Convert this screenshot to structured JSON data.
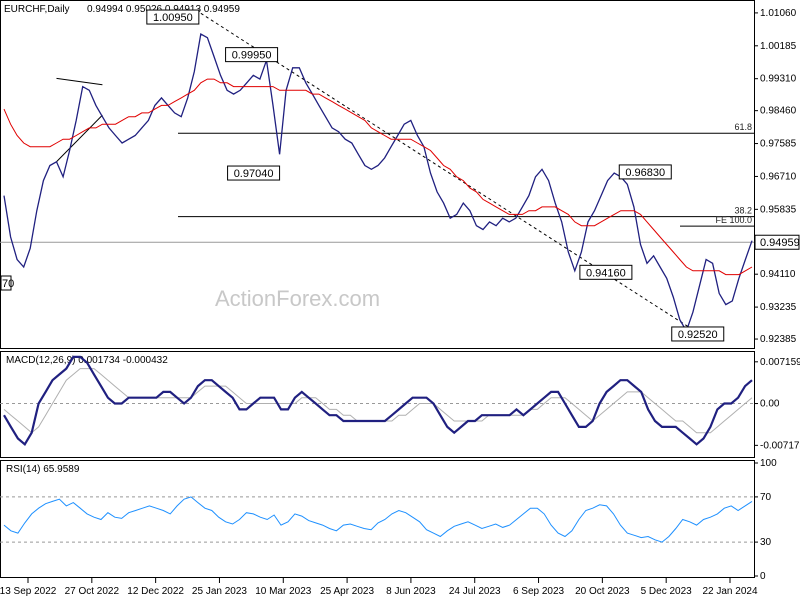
{
  "chart_data": {
    "type": "line",
    "symbol_line": "EURCHF,Daily",
    "ohlc_line": "0.94994 0.95026 0.94913 0.94959",
    "watermark": "ActionForex.com",
    "x_ticks": [
      "13 Sep 2022",
      "27 Oct 2022",
      "12 Dec 2022",
      "25 Jan 2023",
      "10 Mar 2023",
      "25 Apr 2023",
      "8 Jun 2023",
      "24 Jul 2023",
      "6 Sep 2023",
      "20 Oct 2023",
      "5 Dec 2023",
      "22 Jan 2024"
    ],
    "price_panel": {
      "ylim": [
        0.922,
        1.0135
      ],
      "y_ticks": [
        "1.01060",
        "1.00185",
        "0.99310",
        "0.98460",
        "0.97585",
        "0.96710",
        "0.95835",
        "0.94959",
        "0.94110",
        "0.93235",
        "0.92385"
      ],
      "last_price": "0.94959",
      "series": [
        {
          "type": "line",
          "color": "#202080",
          "values": [
            0.962,
            0.951,
            0.945,
            0.943,
            0.948,
            0.958,
            0.966,
            0.97,
            0.971,
            0.967,
            0.974,
            0.982,
            0.991,
            0.99,
            0.986,
            0.983,
            0.98,
            0.978,
            0.976,
            0.977,
            0.978,
            0.98,
            0.982,
            0.986,
            0.988,
            0.986,
            0.984,
            0.983,
            0.988,
            0.995,
            1.005,
            1.004,
            0.999,
            0.994,
            0.99,
            0.989,
            0.99,
            0.992,
            0.994,
            0.993,
            0.998,
            0.986,
            0.973,
            0.99,
            0.996,
            0.996,
            0.992,
            0.989,
            0.986,
            0.983,
            0.98,
            0.979,
            0.977,
            0.976,
            0.973,
            0.97,
            0.969,
            0.97,
            0.972,
            0.975,
            0.978,
            0.981,
            0.982,
            0.978,
            0.975,
            0.968,
            0.963,
            0.96,
            0.956,
            0.957,
            0.96,
            0.958,
            0.954,
            0.953,
            0.955,
            0.954,
            0.956,
            0.955,
            0.956,
            0.959,
            0.962,
            0.967,
            0.969,
            0.966,
            0.96,
            0.955,
            0.947,
            0.942,
            0.947,
            0.955,
            0.958,
            0.962,
            0.966,
            0.968,
            0.967,
            0.965,
            0.959,
            0.949,
            0.944,
            0.946,
            0.943,
            0.94,
            0.935,
            0.929,
            0.926,
            0.931,
            0.938,
            0.945,
            0.944,
            0.936,
            0.933,
            0.934,
            0.94,
            0.945,
            0.95
          ]
        },
        {
          "name": "",
          "type": "line",
          "color": "#e00000",
          "values": [
            0.985,
            0.981,
            0.978,
            0.976,
            0.975,
            0.975,
            0.975,
            0.975,
            0.976,
            0.977,
            0.977,
            0.978,
            0.979,
            0.98,
            0.98,
            0.981,
            0.981,
            0.981,
            0.982,
            0.983,
            0.983,
            0.984,
            0.984,
            0.985,
            0.986,
            0.986,
            0.987,
            0.988,
            0.989,
            0.99,
            0.992,
            0.993,
            0.993,
            0.992,
            0.992,
            0.991,
            0.991,
            0.991,
            0.991,
            0.991,
            0.991,
            0.991,
            0.99,
            0.99,
            0.99,
            0.99,
            0.99,
            0.989,
            0.989,
            0.988,
            0.987,
            0.986,
            0.985,
            0.984,
            0.983,
            0.982,
            0.98,
            0.979,
            0.978,
            0.977,
            0.977,
            0.977,
            0.977,
            0.976,
            0.975,
            0.974,
            0.972,
            0.97,
            0.969,
            0.967,
            0.966,
            0.964,
            0.963,
            0.961,
            0.96,
            0.959,
            0.958,
            0.957,
            0.957,
            0.957,
            0.958,
            0.958,
            0.959,
            0.959,
            0.959,
            0.958,
            0.957,
            0.955,
            0.954,
            0.954,
            0.954,
            0.955,
            0.956,
            0.957,
            0.958,
            0.958,
            0.958,
            0.957,
            0.955,
            0.953,
            0.951,
            0.949,
            0.947,
            0.945,
            0.943,
            0.942,
            0.942,
            0.942,
            0.942,
            0.942,
            0.941,
            0.941,
            0.941,
            0.942,
            0.943
          ]
        }
      ],
      "levels": [
        {
          "label": "61.8",
          "value": 0.9786
        },
        {
          "label": "38.2",
          "value": 0.9564
        },
        {
          "label": "",
          "value": 0.9496
        }
      ],
      "fe_segment": {
        "label": "FE 100.0",
        "value": 0.9539
      },
      "trendlines": [
        {
          "style": "solid",
          "points": [
            [
              8,
              0.9932
            ],
            [
              15,
              0.9915
            ]
          ]
        },
        {
          "style": "solid",
          "points": [
            [
              8,
              0.971
            ],
            [
              15,
              0.9834
            ]
          ]
        },
        {
          "style": "dashed",
          "points": [
            [
              30,
              1.0105
            ],
            [
              106,
              0.9252
            ]
          ]
        }
      ],
      "annotations": [
        {
          "text": "1.00950",
          "value": 1.0095,
          "idx": 30,
          "pos": "left"
        },
        {
          "text": "0.99950",
          "value": 0.9995,
          "idx": 42,
          "pos": "left"
        },
        {
          "text": "0.97040",
          "value": 0.9704,
          "idx": 42,
          "pos": "below"
        },
        {
          "text": "0.96830",
          "value": 0.9683,
          "idx": 102,
          "pos": "left"
        },
        {
          "text": "0.94160",
          "value": 0.9416,
          "idx": 96,
          "pos": "left"
        },
        {
          "text": "0.92520",
          "value": 0.9252,
          "idx": 110,
          "pos": "left"
        }
      ],
      "cut_label": "70"
    },
    "macd_panel": {
      "title": "MACD(12,26,9) 0.001734 -0.000432",
      "ylim": [
        -0.009,
        0.0085
      ],
      "y_ticks": [
        "0.007159",
        "0.00",
        "-0.007173"
      ],
      "zero_label": "0.00",
      "series": [
        {
          "type": "line",
          "color": "#202080",
          "values": [
            -0.002,
            -0.004,
            -0.006,
            -0.007,
            -0.005,
            0.0,
            0.002,
            0.004,
            0.005,
            0.006,
            0.008,
            0.008,
            0.007,
            0.005,
            0.003,
            0.001,
            0.0,
            0.0,
            0.001,
            0.001,
            0.001,
            0.001,
            0.001,
            0.002,
            0.002,
            0.001,
            0.0,
            0.001,
            0.003,
            0.004,
            0.004,
            0.003,
            0.002,
            0.001,
            -0.001,
            -0.001,
            0.0,
            0.001,
            0.001,
            0.001,
            -0.001,
            -0.001,
            0.001,
            0.002,
            0.001,
            0.0,
            -0.001,
            -0.002,
            -0.002,
            -0.003,
            -0.003,
            -0.003,
            -0.003,
            -0.003,
            -0.003,
            -0.003,
            -0.002,
            -0.001,
            0.0,
            0.001,
            0.001,
            0.001,
            0.0,
            -0.002,
            -0.004,
            -0.005,
            -0.004,
            -0.003,
            -0.003,
            -0.002,
            -0.002,
            -0.002,
            -0.002,
            -0.002,
            -0.001,
            -0.002,
            -0.001,
            0.0,
            0.001,
            0.002,
            0.002,
            0.0,
            -0.002,
            -0.004,
            -0.004,
            -0.003,
            0.0,
            0.002,
            0.003,
            0.004,
            0.004,
            0.003,
            0.002,
            -0.001,
            -0.003,
            -0.004,
            -0.004,
            -0.004,
            -0.005,
            -0.006,
            -0.007,
            -0.006,
            -0.004,
            -0.001,
            0.0,
            0.0,
            0.001,
            0.003,
            0.004
          ]
        },
        {
          "type": "line",
          "color": "#b0b0b0",
          "values": [
            -0.001,
            -0.002,
            -0.003,
            -0.004,
            -0.005,
            -0.004,
            -0.002,
            0.0,
            0.002,
            0.004,
            0.005,
            0.006,
            0.006,
            0.006,
            0.005,
            0.004,
            0.003,
            0.002,
            0.001,
            0.001,
            0.001,
            0.001,
            0.001,
            0.001,
            0.001,
            0.001,
            0.001,
            0.001,
            0.002,
            0.003,
            0.003,
            0.003,
            0.003,
            0.002,
            0.001,
            0.0,
            0.0,
            0.0,
            0.0,
            0.0,
            0.0,
            0.0,
            0.0,
            0.001,
            0.001,
            0.001,
            0.0,
            -0.001,
            -0.001,
            -0.002,
            -0.002,
            -0.003,
            -0.003,
            -0.003,
            -0.003,
            -0.003,
            -0.003,
            -0.002,
            -0.002,
            -0.001,
            0.0,
            0.0,
            0.0,
            -0.001,
            -0.002,
            -0.003,
            -0.003,
            -0.003,
            -0.003,
            -0.003,
            -0.002,
            -0.002,
            -0.002,
            -0.002,
            -0.002,
            -0.002,
            -0.001,
            -0.001,
            0.0,
            0.001,
            0.001,
            0.001,
            0.0,
            -0.001,
            -0.002,
            -0.003,
            -0.002,
            -0.001,
            0.0,
            0.001,
            0.002,
            0.002,
            0.002,
            0.001,
            0.0,
            -0.001,
            -0.002,
            -0.003,
            -0.003,
            -0.004,
            -0.005,
            -0.005,
            -0.005,
            -0.004,
            -0.003,
            -0.002,
            -0.001,
            0.0,
            0.001
          ]
        }
      ]
    },
    "rsi_panel": {
      "title": "RSI(14) 65.9589",
      "ylim": [
        0,
        100
      ],
      "y_ticks": [
        "100",
        "70",
        "30",
        "0"
      ],
      "levels": [
        70,
        30
      ],
      "series": [
        {
          "type": "line",
          "color": "#1e90ff",
          "values": [
            45,
            40,
            38,
            47,
            55,
            60,
            64,
            66,
            68,
            62,
            65,
            60,
            55,
            52,
            50,
            56,
            52,
            51,
            56,
            58,
            60,
            62,
            60,
            58,
            55,
            62,
            68,
            70,
            65,
            60,
            58,
            52,
            48,
            46,
            50,
            56,
            55,
            52,
            50,
            54,
            45,
            48,
            55,
            53,
            49,
            47,
            45,
            42,
            40,
            45,
            46,
            44,
            42,
            41,
            47,
            50,
            55,
            58,
            56,
            52,
            48,
            41,
            38,
            35,
            40,
            44,
            46,
            48,
            45,
            42,
            44,
            46,
            43,
            45,
            50,
            55,
            60,
            60,
            55,
            45,
            38,
            35,
            40,
            50,
            58,
            60,
            63,
            62,
            55,
            45,
            38,
            36,
            34,
            35,
            32,
            30,
            35,
            42,
            50,
            48,
            45,
            50,
            52,
            55,
            60,
            62,
            58,
            62,
            66
          ]
        }
      ]
    }
  }
}
